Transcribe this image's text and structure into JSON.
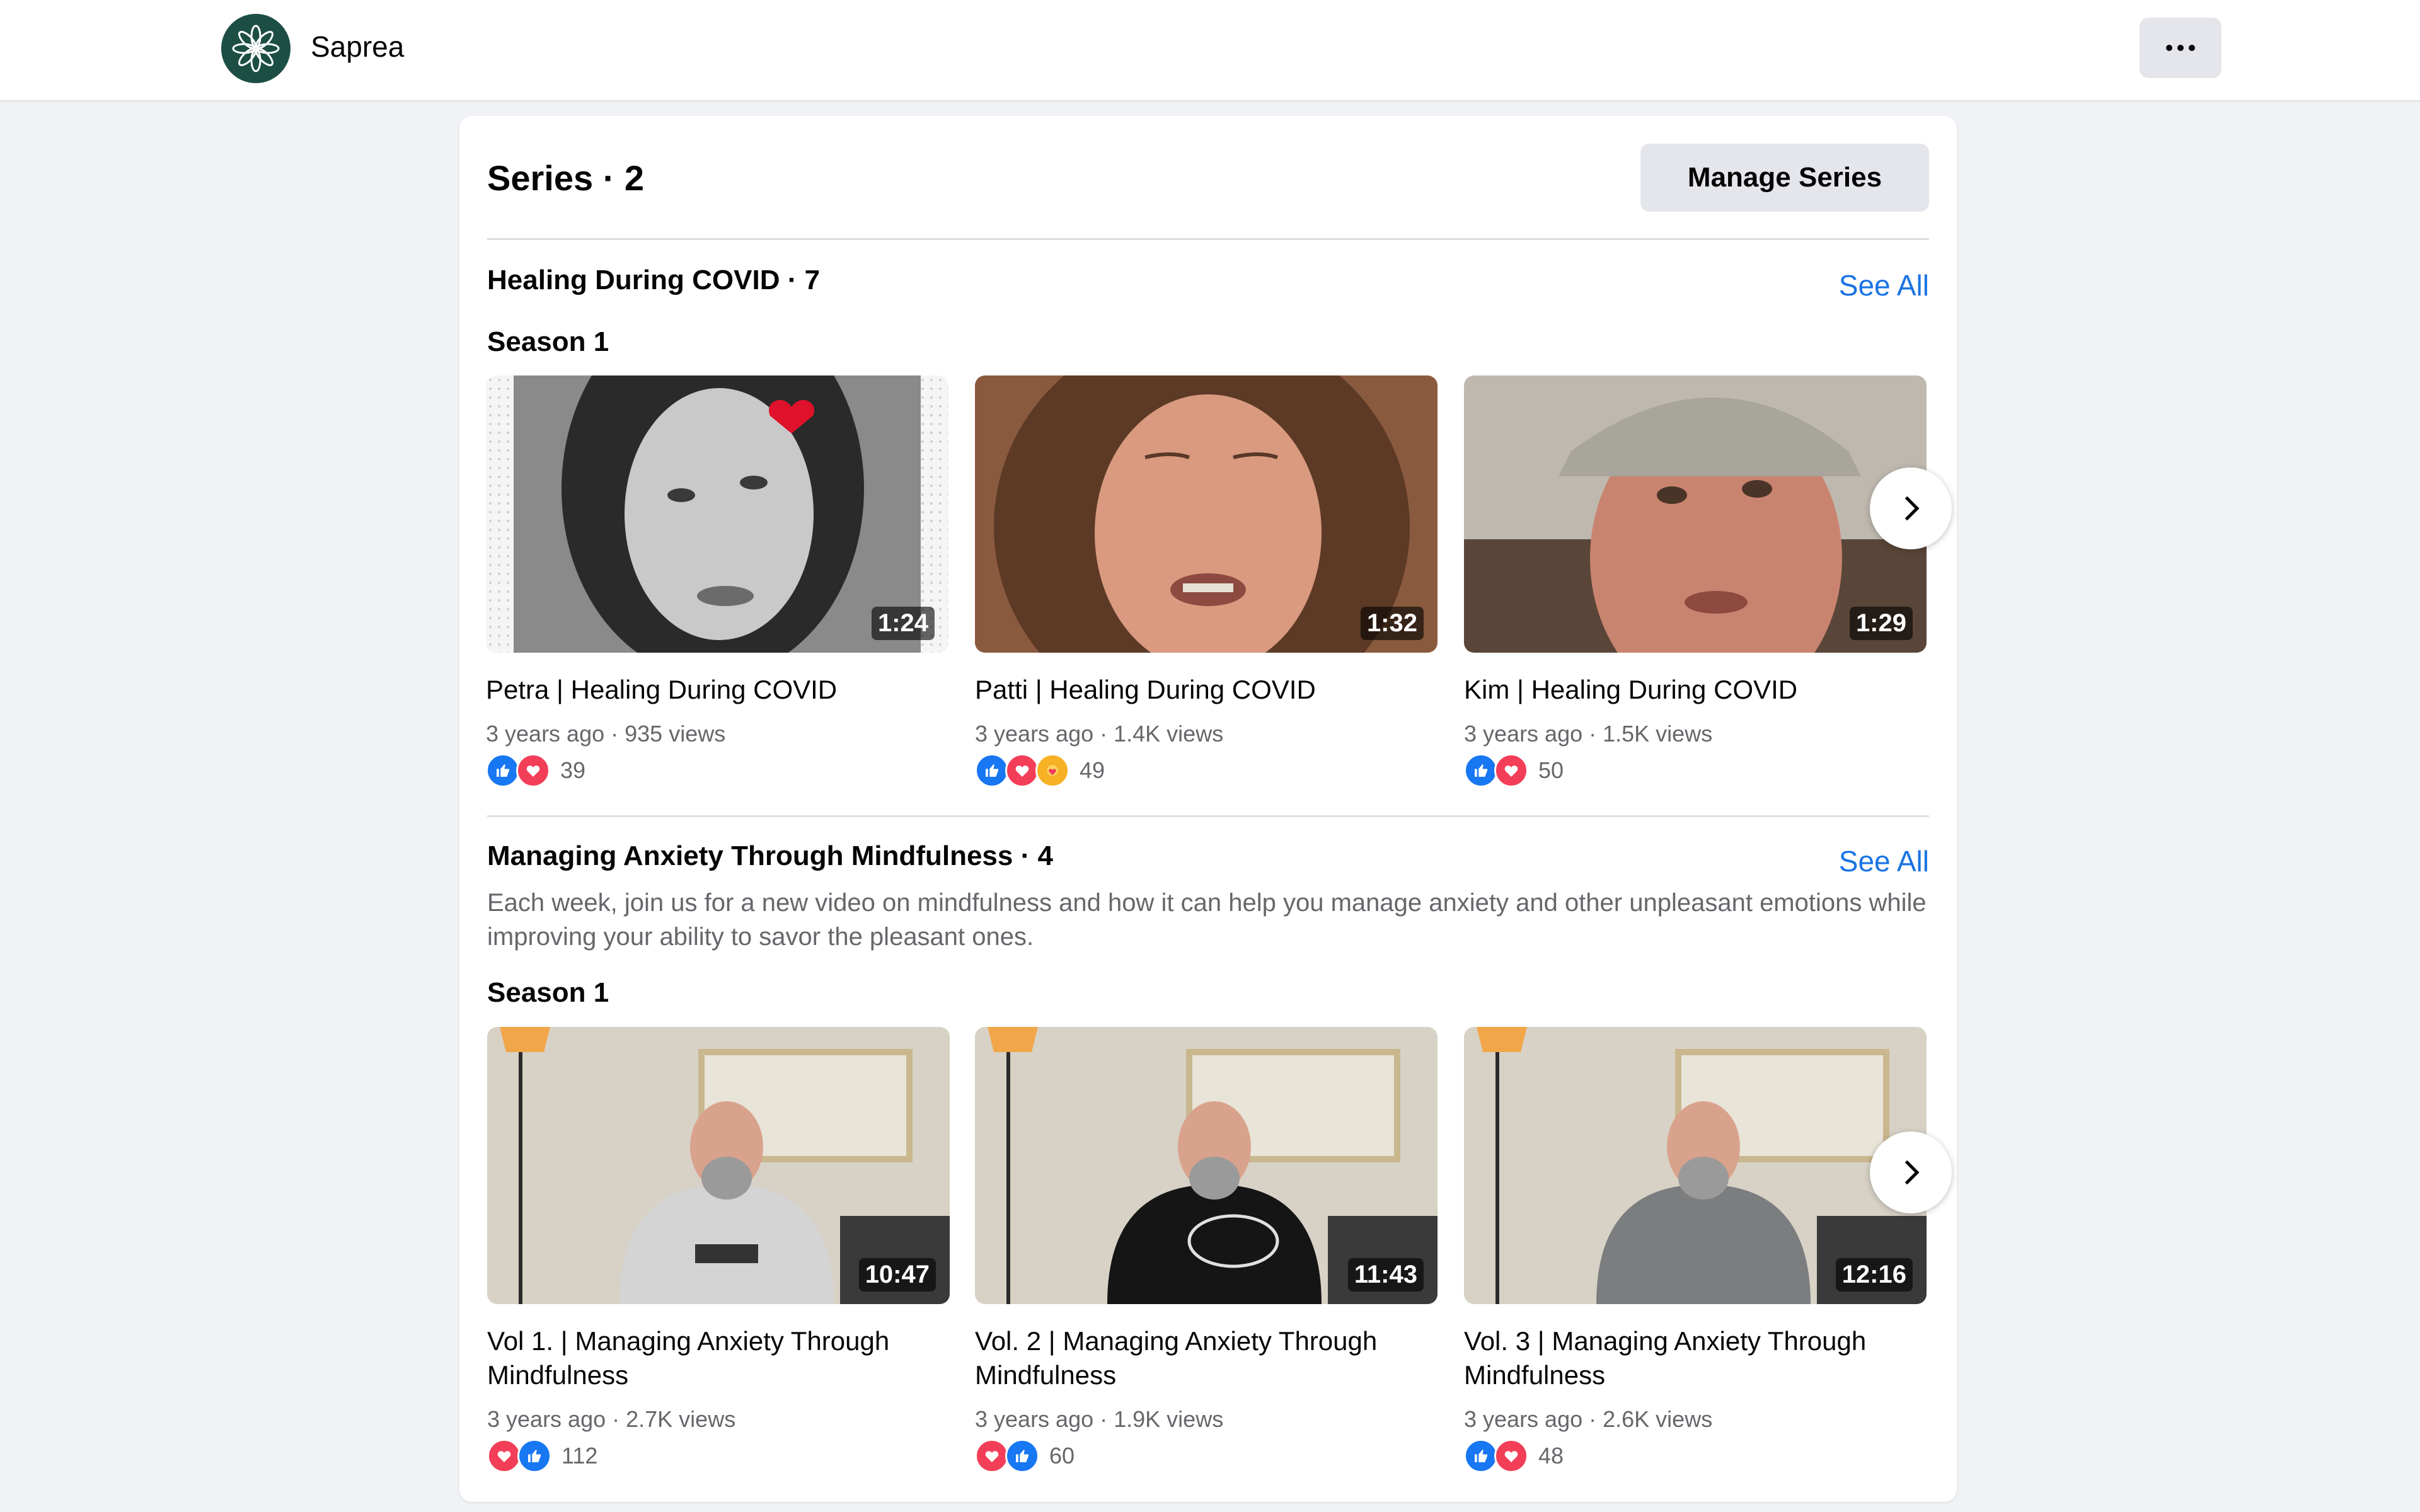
{
  "header": {
    "page_name": "Saprea",
    "logo_icon": "flower-logo-icon",
    "more_icon": "more-options-icon"
  },
  "main": {
    "series_title": "Series · 2",
    "manage_label": "Manage Series",
    "series": [
      {
        "title": "Healing During COVID · 7",
        "see_all": "See All",
        "description": "",
        "season": "Season 1",
        "videos": [
          {
            "title": "Petra | Healing During COVID",
            "duration": "1:24",
            "age": "3 years ago",
            "views": "935 views",
            "reactions": [
              "like",
              "love"
            ],
            "count": "39"
          },
          {
            "title": "Patti | Healing During COVID",
            "duration": "1:32",
            "age": "3 years ago",
            "views": "1.4K views",
            "reactions": [
              "like",
              "love",
              "care"
            ],
            "count": "49"
          },
          {
            "title": "Kim | Healing During COVID",
            "duration": "1:29",
            "age": "3 years ago",
            "views": "1.5K views",
            "reactions": [
              "like",
              "love"
            ],
            "count": "50"
          }
        ]
      },
      {
        "title": "Managing Anxiety Through Mindfulness · 4",
        "see_all": "See All",
        "description": "Each week, join us for a new video on mindfulness and how it can help you manage anxiety and other unpleasant emotions while improving your ability to savor the pleasant ones.",
        "season": "Season 1",
        "videos": [
          {
            "title": "Vol 1. | Managing Anxiety Through Mindfulness",
            "duration": "10:47",
            "age": "3 years ago",
            "views": "2.7K views",
            "reactions": [
              "love",
              "like"
            ],
            "count": "112"
          },
          {
            "title": "Vol. 2 | Managing Anxiety Through Mindfulness",
            "duration": "11:43",
            "age": "3 years ago",
            "views": "1.9K views",
            "reactions": [
              "love",
              "like"
            ],
            "count": "60"
          },
          {
            "title": "Vol. 3 | Managing Anxiety Through Mindfulness",
            "duration": "12:16",
            "age": "3 years ago",
            "views": "2.6K views",
            "reactions": [
              "like",
              "love"
            ],
            "count": "48"
          }
        ]
      }
    ]
  },
  "colors": {
    "accent": "#1b74e4",
    "like": "#1877f2",
    "love": "#f33e58",
    "logo": "#1c4e44"
  }
}
